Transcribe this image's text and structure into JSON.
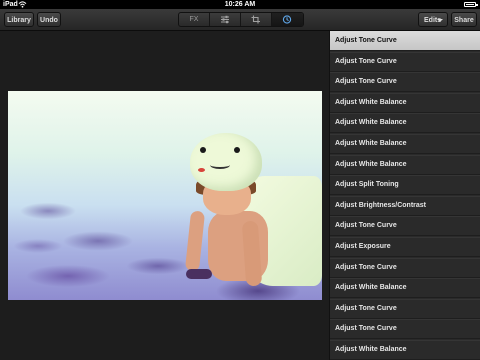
{
  "status_bar": {
    "carrier": "iPad",
    "time": "10:26 AM"
  },
  "toolbar": {
    "library_label": "Library",
    "undo_label": "Undo",
    "edits_label": "Edits",
    "share_label": "Share",
    "tabs": [
      {
        "label": "FX",
        "icon": "fx-text"
      },
      {
        "label": "",
        "icon": "sliders-icon"
      },
      {
        "label": "",
        "icon": "crop-icon"
      },
      {
        "label": "",
        "icon": "history-clock-icon"
      }
    ],
    "selected_tab": 3
  },
  "edits_panel": {
    "selected_index": 0,
    "items": [
      "Adjust Tone Curve",
      "Adjust Tone Curve",
      "Adjust Tone Curve",
      "Adjust White Balance",
      "Adjust White Balance",
      "Adjust White Balance",
      "Adjust White Balance",
      "Adjust Split Toning",
      "Adjust Brightness/Contrast",
      "Adjust Tone Curve",
      "Adjust Exposure",
      "Adjust Tone Curve",
      "Adjust White Balance",
      "Adjust Tone Curve",
      "Adjust Tone Curve",
      "Adjust White Balance"
    ]
  }
}
